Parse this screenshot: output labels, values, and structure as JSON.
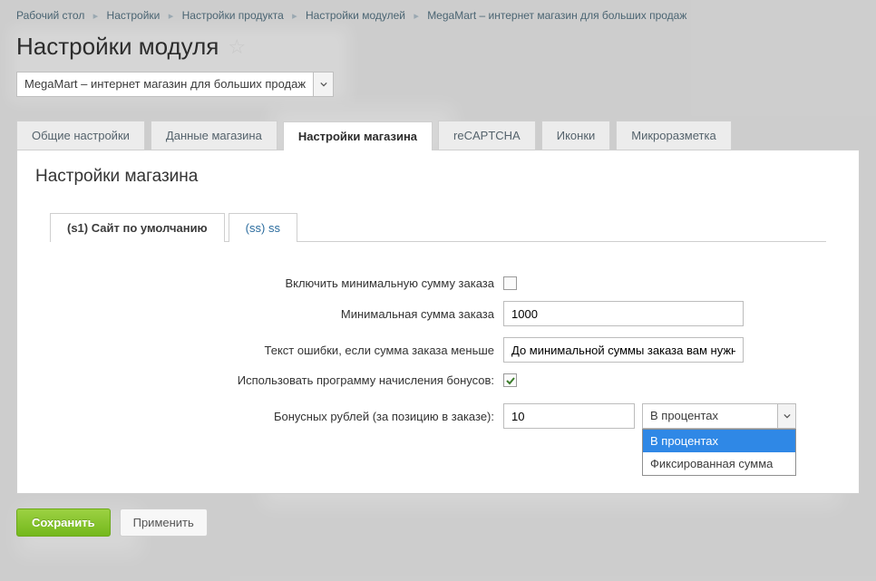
{
  "breadcrumb": {
    "items": [
      {
        "label": "Рабочий стол"
      },
      {
        "label": "Настройки"
      },
      {
        "label": "Настройки продукта"
      },
      {
        "label": "Настройки модулей"
      },
      {
        "label": "MegaMart – интернет магазин для больших продаж"
      }
    ]
  },
  "page": {
    "title": "Настройки модуля"
  },
  "module_select": {
    "value": "MegaMart – интернет магазин для больших продаж"
  },
  "tabs": {
    "items": [
      {
        "label": "Общие настройки",
        "active": false
      },
      {
        "label": "Данные магазина",
        "active": false
      },
      {
        "label": "Настройки магазина",
        "active": true
      },
      {
        "label": "reCAPTCHA",
        "active": false
      },
      {
        "label": "Иконки",
        "active": false
      },
      {
        "label": "Микроразметка",
        "active": false
      }
    ]
  },
  "panel": {
    "heading": "Настройки магазина",
    "inner_tabs": [
      {
        "label": "(s1) Сайт по умолчанию",
        "active": true
      },
      {
        "label": "(ss) ss",
        "active": false
      }
    ],
    "fields": {
      "enable_min": {
        "label": "Включить минимальную сумму заказа",
        "checked": false
      },
      "min_sum": {
        "label": "Минимальная сумма заказа",
        "value": "1000"
      },
      "err_text": {
        "label": "Текст ошибки, если сумма заказа меньше",
        "value": "До минимальной суммы заказа вам нужно ,"
      },
      "use_bonus": {
        "label": "Использовать программу начисления бонусов:",
        "checked": true
      },
      "bonus_rub": {
        "label": "Бонусных рублей (за позицию в заказе):",
        "value": "10",
        "select_value": "В процентах",
        "options": [
          {
            "label": "В процентах",
            "selected": true
          },
          {
            "label": "Фиксированная сумма",
            "selected": false
          }
        ]
      }
    }
  },
  "footer": {
    "save": "Сохранить",
    "apply": "Применить"
  }
}
